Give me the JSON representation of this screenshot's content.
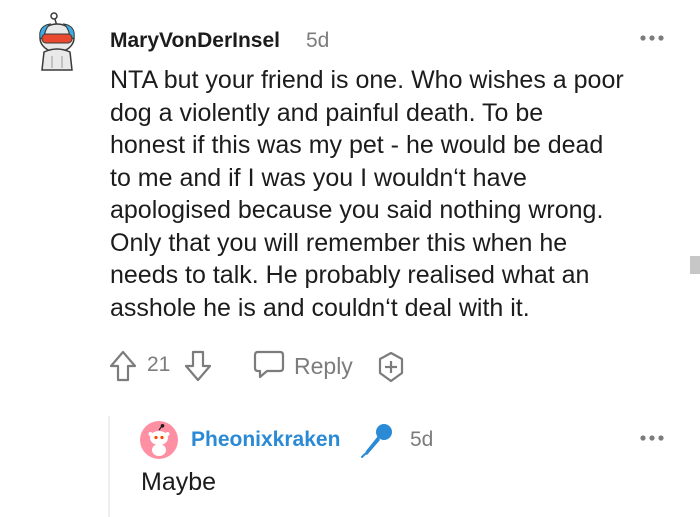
{
  "comment": {
    "author": "MaryVonDerInsel",
    "age": "5d",
    "avatar_icon": "snoo-avatar-icon",
    "more_icon": "more-options-icon",
    "body_lines": [
      "NTA but your friend is one. Who wishes a poor",
      "dog a violently and painful death. To be",
      "honest if this was my pet - he would be dead",
      "to me and if I was you I wouldn‘t have",
      "apologised because you said nothing wrong.",
      "Only that you will remember this when he",
      "needs to talk. He probably realised what an",
      "asshole he is and couldn‘t deal with it."
    ],
    "actions": {
      "upvote_icon": "upvote-arrow-icon",
      "score": "21",
      "downvote_icon": "downvote-arrow-icon",
      "reply_icon": "speech-bubble-icon",
      "reply_label": "Reply",
      "award_icon": "add-award-icon"
    }
  },
  "reply": {
    "author": "Pheonixkraken",
    "author_color": "#2a8ad6",
    "flair_icon": "microphone-icon",
    "age": "5d",
    "body": "Maybe",
    "avatar_color": "#ff8fa3"
  },
  "colors": {
    "text": "#1c1c1c",
    "meta": "#7c7c7c",
    "thread": "#edeff1"
  }
}
